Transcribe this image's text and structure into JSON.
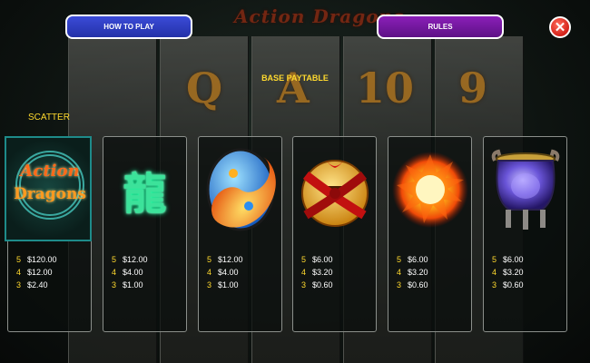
{
  "logo_text": "Action Dragons",
  "buttons": {
    "how_to_play": "HOW TO PLAY",
    "rules": "RULES",
    "close": "✕"
  },
  "title": "BASE PAYTABLE",
  "scatter_label": "SCATTER",
  "scatter_logo": {
    "line1": "Action",
    "line2": "Dragons"
  },
  "background_reel_letters": [
    "Q",
    "A",
    "10",
    "9"
  ],
  "colors": {
    "accent_yellow": "#ffd92e",
    "how_to_play": "#3b4bd8",
    "rules": "#8a1fb8",
    "close": "#d4221a"
  },
  "cards": [
    {
      "symbol": "action-dragons-scatter-icon",
      "pays": [
        {
          "count": "5",
          "amount": "$120.00"
        },
        {
          "count": "4",
          "amount": "$12.00"
        },
        {
          "count": "3",
          "amount": "$2.40"
        }
      ]
    },
    {
      "symbol": "dragon-character-icon",
      "glyph": "龍",
      "pays": [
        {
          "count": "5",
          "amount": "$12.00"
        },
        {
          "count": "4",
          "amount": "$4.00"
        },
        {
          "count": "3",
          "amount": "$1.00"
        }
      ]
    },
    {
      "symbol": "yin-yang-orb-icon",
      "pays": [
        {
          "count": "5",
          "amount": "$12.00"
        },
        {
          "count": "4",
          "amount": "$4.00"
        },
        {
          "count": "3",
          "amount": "$1.00"
        }
      ]
    },
    {
      "symbol": "coin-ribbon-icon",
      "pays": [
        {
          "count": "5",
          "amount": "$6.00"
        },
        {
          "count": "4",
          "amount": "$3.20"
        },
        {
          "count": "3",
          "amount": "$0.60"
        }
      ]
    },
    {
      "symbol": "fireball-icon",
      "pays": [
        {
          "count": "5",
          "amount": "$6.00"
        },
        {
          "count": "4",
          "amount": "$3.20"
        },
        {
          "count": "3",
          "amount": "$0.60"
        }
      ]
    },
    {
      "symbol": "incense-urn-icon",
      "pays": [
        {
          "count": "5",
          "amount": "$6.00"
        },
        {
          "count": "4",
          "amount": "$3.20"
        },
        {
          "count": "3",
          "amount": "$0.60"
        }
      ]
    }
  ]
}
